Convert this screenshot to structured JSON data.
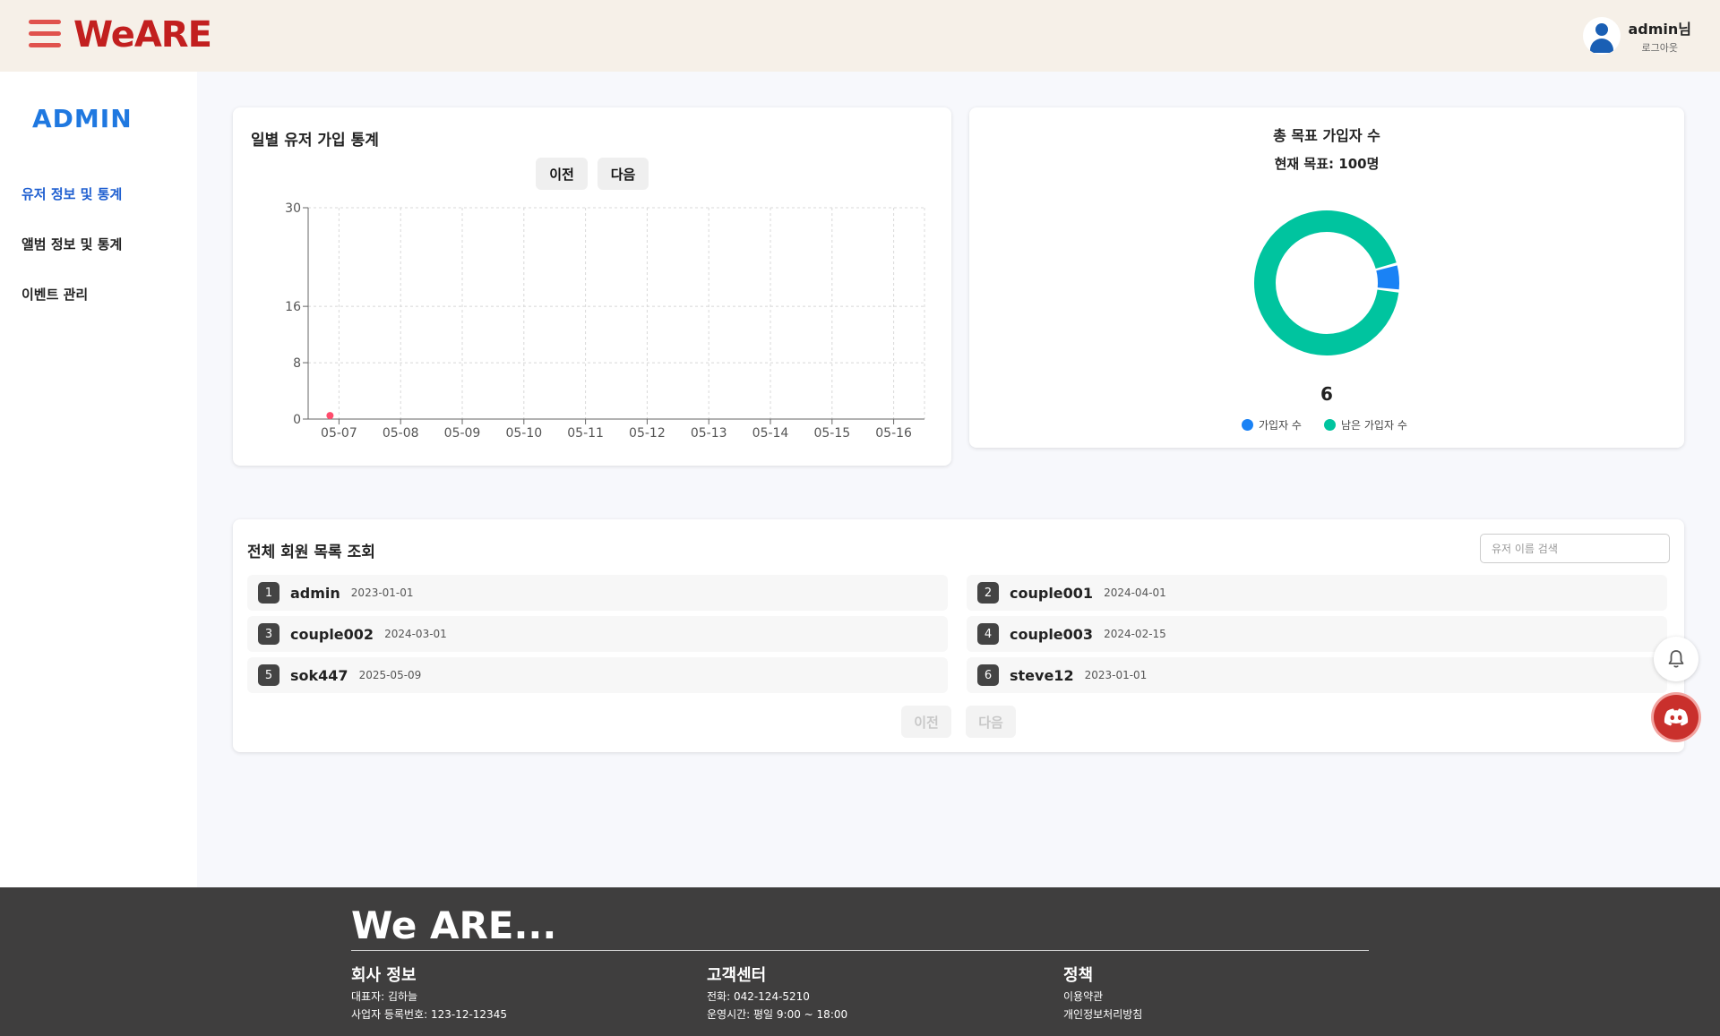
{
  "header": {
    "logo": "WeARE",
    "user_name": "admin님",
    "logout": "로그아웃"
  },
  "sidebar": {
    "title": "ADMIN",
    "items": [
      {
        "label": "유저 정보 및 통계",
        "active": true
      },
      {
        "label": "앨범 정보 및 통계",
        "active": false
      },
      {
        "label": "이벤트 관리",
        "active": false
      }
    ]
  },
  "daily_chart": {
    "title": "일별 유저 가입 통계",
    "prev_label": "이전",
    "next_label": "다음"
  },
  "goal_card": {
    "title": "총 목표 가입자 수",
    "current_goal": "현재 목표: 100명",
    "center_value": "6",
    "legend": [
      {
        "label": "가입자 수",
        "color": "#1a82f5"
      },
      {
        "label": "남은 가입자 수",
        "color": "#00c49f"
      }
    ]
  },
  "members": {
    "title": "전체 회원 목록 조회",
    "search_placeholder": "유저 이름 검색",
    "list": [
      {
        "num": "1",
        "name": "admin",
        "date": "2023-01-01"
      },
      {
        "num": "2",
        "name": "couple001",
        "date": "2024-04-01"
      },
      {
        "num": "3",
        "name": "couple002",
        "date": "2024-03-01"
      },
      {
        "num": "4",
        "name": "couple003",
        "date": "2024-02-15"
      },
      {
        "num": "5",
        "name": "sok447",
        "date": "2025-05-09"
      },
      {
        "num": "6",
        "name": "steve12",
        "date": "2023-01-01"
      }
    ],
    "prev_label": "이전",
    "next_label": "다음"
  },
  "footer": {
    "logo": "We ARE...",
    "company_title": "회사 정보",
    "company_ceo": "대표자: 김하늘",
    "company_reg": "사업자 등록번호: 123-12-12345",
    "support_title": "고객센터",
    "support_phone": "전화: 042-124-5210",
    "support_hours": "운영시간: 평일 9:00 ~ 18:00",
    "policy_title": "정책",
    "policy_terms": "이용약관",
    "policy_privacy": "개인정보처리방침"
  },
  "chart_data": [
    {
      "type": "scatter",
      "title": "일별 유저 가입 통계",
      "categories": [
        "05-07",
        "05-08",
        "05-09",
        "05-10",
        "05-11",
        "05-12",
        "05-13",
        "05-14",
        "05-15",
        "05-16"
      ],
      "y_ticks": [
        0,
        8,
        16,
        30
      ],
      "ylim": [
        0,
        30
      ],
      "series": [
        {
          "values": [
            1,
            0,
            0,
            0,
            0,
            0,
            0,
            0,
            0,
            0
          ],
          "color": "#ff4d6d"
        }
      ],
      "grid": true
    },
    {
      "type": "pie",
      "title": "총 목표 가입자 수",
      "slices": [
        {
          "label": "가입자 수",
          "value": 6,
          "color": "#1a82f5"
        },
        {
          "label": "남은 가입자 수",
          "value": 94,
          "color": "#00c49f"
        }
      ]
    }
  ]
}
